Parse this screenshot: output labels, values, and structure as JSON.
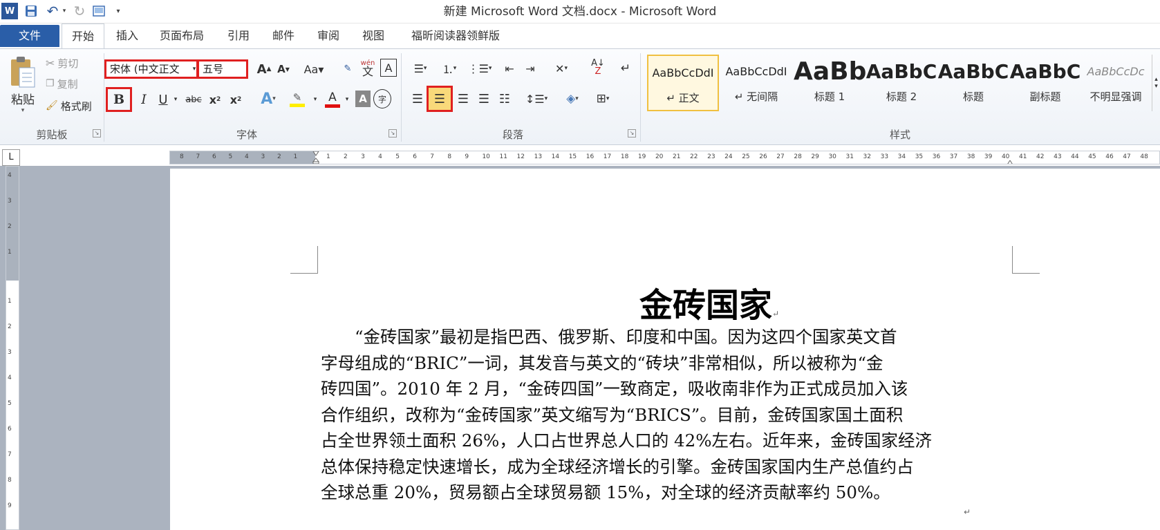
{
  "window": {
    "title": "新建 Microsoft Word 文档.docx - Microsoft Word"
  },
  "quick_access": [
    {
      "icon": "word-app-icon",
      "glyph": "W"
    },
    {
      "icon": "save-icon",
      "glyph": "💾"
    },
    {
      "icon": "undo-icon",
      "glyph": "↶"
    },
    {
      "icon": "redo-icon",
      "glyph": "↻"
    },
    {
      "icon": "print-preview-icon",
      "glyph": "▣"
    },
    {
      "icon": "customize-qat-icon",
      "glyph": "▾"
    }
  ],
  "tabs": [
    "文件",
    "开始",
    "插入",
    "页面布局",
    "引用",
    "邮件",
    "审阅",
    "视图",
    "福昕阅读器领鲜版"
  ],
  "active_tab": "开始",
  "clipboard": {
    "paste_label": "粘贴",
    "cut_label": "剪切",
    "copy_label": "复制",
    "format_painter_label": "格式刷",
    "group_label": "剪贴板"
  },
  "font": {
    "font_name": "宋体 (中文正文",
    "font_size": "五号",
    "group_label": "字体"
  },
  "paragraph": {
    "group_label": "段落"
  },
  "styles": {
    "group_label": "样式",
    "items": [
      {
        "preview": "AaBbCcDdI",
        "name": "↵ 正文"
      },
      {
        "preview": "AaBbCcDdI",
        "name": "↵ 无间隔"
      },
      {
        "preview": "AaBb",
        "name": "标题 1"
      },
      {
        "preview": "AaBbC",
        "name": "标题 2"
      },
      {
        "preview": "AaBbC",
        "name": "标题"
      },
      {
        "preview": "AaBbC",
        "name": "副标题"
      },
      {
        "preview": "AaBbCcDc",
        "name": "不明显强调"
      }
    ]
  },
  "ruler": {
    "corner": "L",
    "left_numbers": [
      "8",
      "7",
      "6",
      "5",
      "4",
      "3",
      "2",
      "1"
    ],
    "numbers": [
      "1",
      "2",
      "3",
      "4",
      "5",
      "6",
      "7",
      "8",
      "9",
      "10",
      "11",
      "12",
      "13",
      "14",
      "15",
      "16",
      "17",
      "18",
      "19",
      "20",
      "21",
      "22",
      "23",
      "24",
      "25",
      "26",
      "27",
      "28",
      "29",
      "30",
      "31",
      "32",
      "33",
      "34",
      "35",
      "36",
      "37",
      "38",
      "39",
      "40",
      "41",
      "42",
      "43",
      "44",
      "45",
      "46",
      "47",
      "48"
    ],
    "vertical_top": [
      "4",
      "3",
      "2",
      "1"
    ],
    "vertical_numbers": [
      "1",
      "2",
      "3",
      "4",
      "5",
      "6",
      "7",
      "8",
      "9"
    ]
  },
  "document": {
    "title": "金砖国家",
    "lines": [
      "　　“金砖国家”最初是指巴西、俄罗斯、印度和中国。因为这四个国家英文首",
      "字母组成的“BRIC”一词，其发音与英文的“砖块”非常相似，所以被称为“金",
      "砖四国”。2010 年 2 月，“金砖四国”一致商定，吸收南非作为正式成员加入该",
      "合作组织，改称为“金砖国家”英文缩写为“BRICS”。目前，金砖国家国土面积",
      "占全世界领土面积 26%，人口占世界总人口的 42%左右。近年来，金砖国家经济",
      "总体保持稳定快速增长，成为全球经济增长的引擎。金砖国家国内生产总值约占",
      "全球总重 20%，贸易额占全球贸易额 15%，对全球的经济贡献率约 50%。"
    ],
    "paragraph_mark": "↵"
  }
}
